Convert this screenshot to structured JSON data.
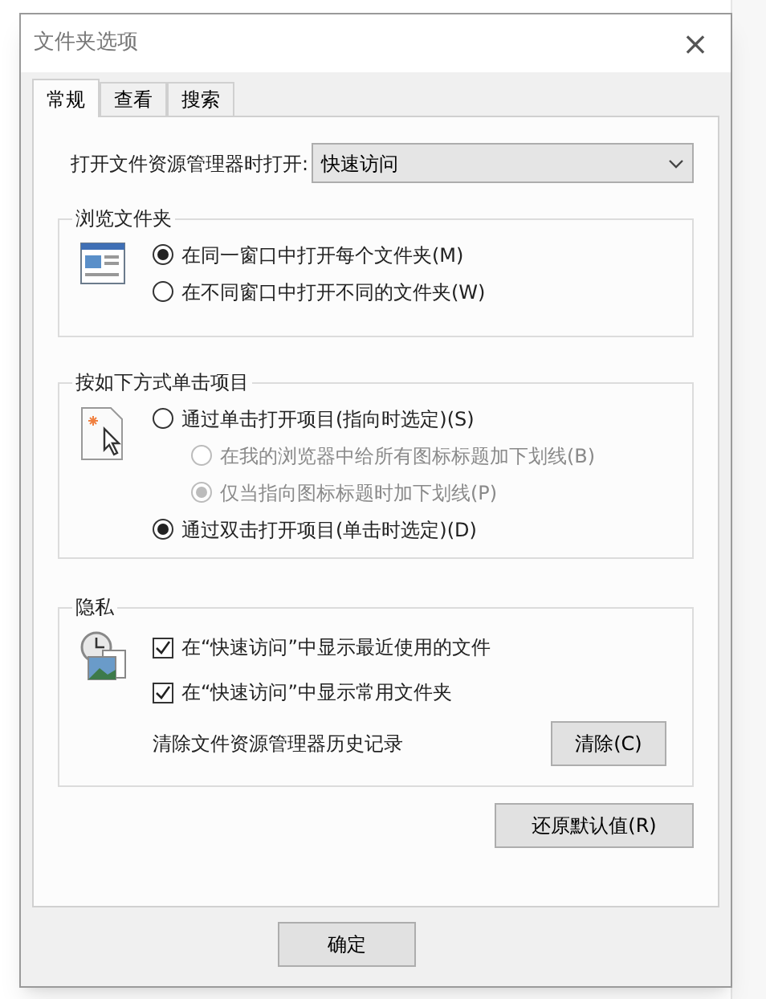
{
  "window": {
    "title": "文件夹选项",
    "close": "×"
  },
  "tabs": [
    {
      "label": "常规",
      "selected": true
    },
    {
      "label": "查看",
      "selected": false
    },
    {
      "label": "搜索",
      "selected": false
    }
  ],
  "open_in": {
    "label": "打开文件资源管理器时打开:",
    "value": "快速访问"
  },
  "groups": [
    {
      "title": "浏览文件夹",
      "items": [
        {
          "kind": "radio",
          "label": "在同一窗口中打开每个文件夹(M)",
          "selected": true,
          "disabled": false
        },
        {
          "kind": "radio",
          "label": "在不同窗口中打开不同的文件夹(W)",
          "selected": false,
          "disabled": false
        }
      ]
    },
    {
      "title": "按如下方式单击项目",
      "items": [
        {
          "kind": "radio",
          "label": "通过单击打开项目(指向时选定)(S)",
          "selected": false,
          "disabled": false,
          "children": [
            {
              "kind": "radio",
              "label": "在我的浏览器中给所有图标标题加下划线(B)",
              "selected": false,
              "disabled": true
            },
            {
              "kind": "radio",
              "label": "仅当指向图标标题时加下划线(P)",
              "selected": true,
              "disabled": true
            }
          ]
        },
        {
          "kind": "radio",
          "label": "通过双击打开项目(单击时选定)(D)",
          "selected": true,
          "disabled": false
        }
      ]
    },
    {
      "title": "隐私",
      "items": [
        {
          "kind": "checkbox",
          "label": "在“快速访问”中显示最近使用的文件",
          "checked": true
        },
        {
          "kind": "checkbox",
          "label": "在“快速访问”中显示常用文件夹",
          "checked": true
        },
        {
          "kind": "action",
          "label": "清除文件资源管理器历史记录",
          "button": "清除(C)"
        }
      ]
    }
  ],
  "restore_button": "还原默认值(R)",
  "footer_buttons": [
    "确定"
  ]
}
